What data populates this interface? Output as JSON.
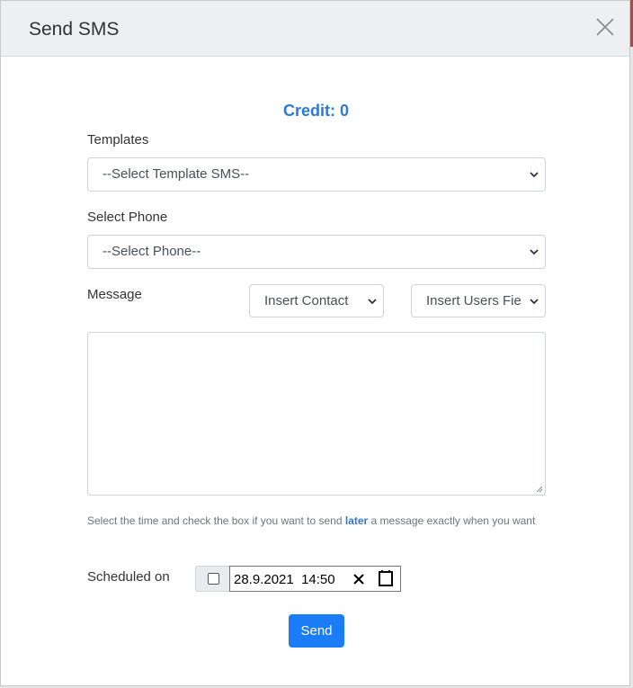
{
  "modal": {
    "title": "Send SMS",
    "credit_label": "Credit: 0"
  },
  "form": {
    "templates_label": "Templates",
    "template_select_value": "--Select Template SMS--",
    "phone_label": "Select Phone",
    "phone_select_value": "--Select Phone--",
    "message_label": "Message",
    "insert_contact_value": "Insert Contact",
    "insert_users_field_value": "Insert Users Fie",
    "message_text": "",
    "help_text_before": "Select the time and check the box if you want to send ",
    "help_text_emphasis": "later",
    "help_text_after": " a message exactly when you want",
    "scheduled_label": "Scheduled on",
    "scheduled_datetime": "28.9.2021  14:50",
    "send_label": "Send"
  },
  "colors": {
    "accent": "#1a7df7",
    "credit": "#2d7ad3",
    "header_bg": "#eeeff1"
  },
  "icons": {
    "close": "close-icon",
    "chevron": "chevron-down-icon",
    "clear": "clear-icon",
    "calendar": "calendar-icon"
  }
}
